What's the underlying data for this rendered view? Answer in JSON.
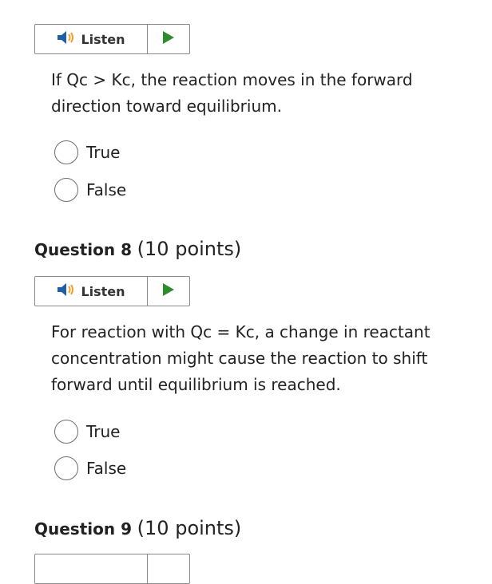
{
  "listen": {
    "label": "Listen",
    "speaker_icon": "speaker-icon",
    "play_icon": "play-icon",
    "play_color": "#2e8b2e"
  },
  "question7": {
    "text": "If Qc > Kc, the reaction moves in the forward direction toward equilibrium.",
    "options": [
      "True",
      "False"
    ]
  },
  "question8": {
    "title": "Question 8",
    "points": "(10 points)",
    "text": "For reaction with Qc = Kc, a change in reactant concentration might cause the reaction to shift forward until equilibrium is reached.",
    "options": [
      "True",
      "False"
    ]
  },
  "question9": {
    "title": "Question 9",
    "points": "(10 points)"
  }
}
